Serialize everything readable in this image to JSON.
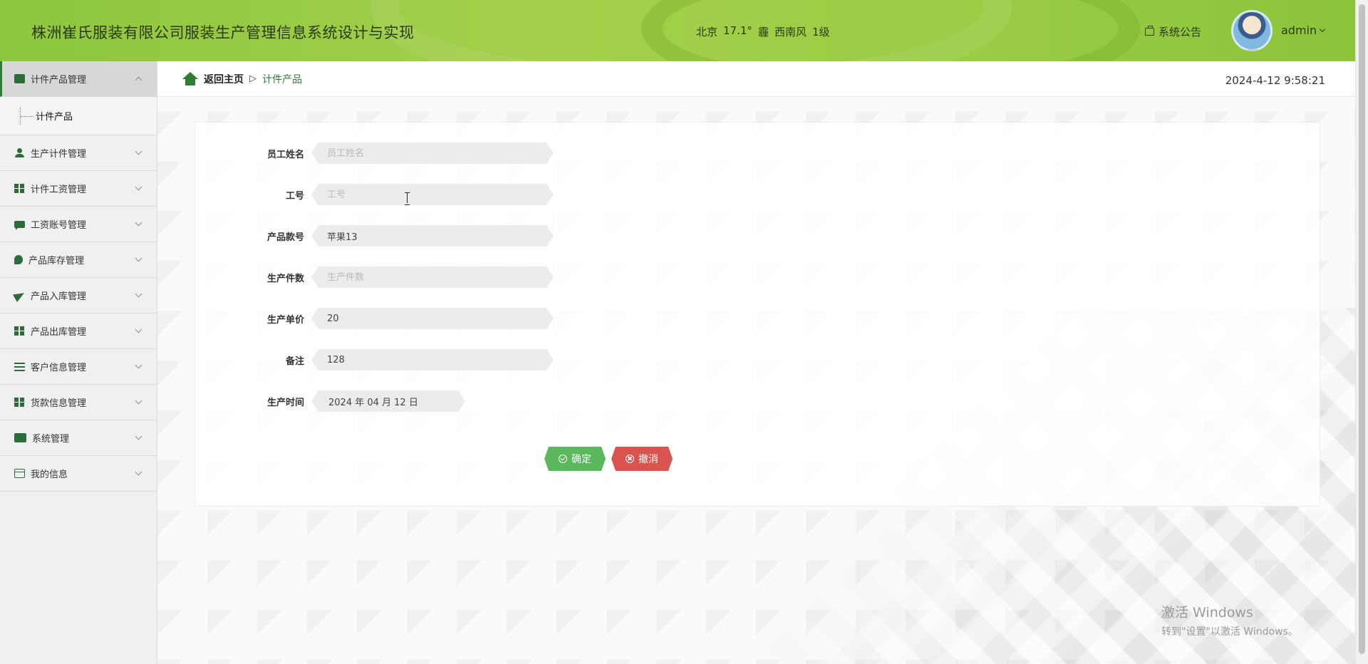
{
  "header": {
    "title": "株洲崔氏服装有限公司服装生产管理信息系统设计与实现",
    "weather": {
      "city": "北京",
      "temp": "17.1°",
      "wind_glyph": "霾",
      "wind": "西南风",
      "level": "1级"
    },
    "notice_label": "系统公告",
    "username": "admin"
  },
  "sidebar": {
    "items": [
      {
        "label": "计件产品管理",
        "icon": "wallet-icon",
        "expanded": true
      },
      {
        "label": "生产计件管理",
        "icon": "user-icon"
      },
      {
        "label": "计件工资管理",
        "icon": "grid-icon"
      },
      {
        "label": "工资账号管理",
        "icon": "chat-icon"
      },
      {
        "label": "产品库存管理",
        "icon": "leaf-icon"
      },
      {
        "label": "产品入库管理",
        "icon": "paper-plane-icon"
      },
      {
        "label": "产品出库管理",
        "icon": "grid-icon"
      },
      {
        "label": "客户信息管理",
        "icon": "list-icon"
      },
      {
        "label": "货款信息管理",
        "icon": "grid-icon"
      },
      {
        "label": "系统管理",
        "icon": "ticket-icon"
      },
      {
        "label": "我的信息",
        "icon": "card-icon"
      }
    ],
    "sub_items": [
      {
        "label": "计件产品"
      }
    ]
  },
  "breadcrumb": {
    "home": "返回主页",
    "separator": "▷",
    "current": "计件产品"
  },
  "datetime": "2024-4-12 9:58:21",
  "form": {
    "fields": [
      {
        "label": "员工姓名",
        "value": "",
        "placeholder": "员工姓名"
      },
      {
        "label": "工号",
        "value": "",
        "placeholder": "工号"
      },
      {
        "label": "产品款号",
        "value": "苹果13",
        "placeholder": "产品款号"
      },
      {
        "label": "生产件数",
        "value": "",
        "placeholder": "生产件数"
      },
      {
        "label": "生产单价",
        "value": "20",
        "placeholder": "生产单价"
      },
      {
        "label": "备注",
        "value": "128",
        "placeholder": "备注"
      },
      {
        "label": "生产时间",
        "value": "2024 年 04 月 12 日",
        "placeholder": ""
      }
    ],
    "confirm_label": "确定",
    "cancel_label": "撤消"
  },
  "watermark": {
    "line1": "激活 Windows",
    "line2": "转到\"设置\"以激活 Windows。"
  },
  "colors": {
    "header_green": "#9bcc45",
    "accent_green": "#2e7d32",
    "confirm": "#5cb85c",
    "cancel": "#d9534f"
  }
}
